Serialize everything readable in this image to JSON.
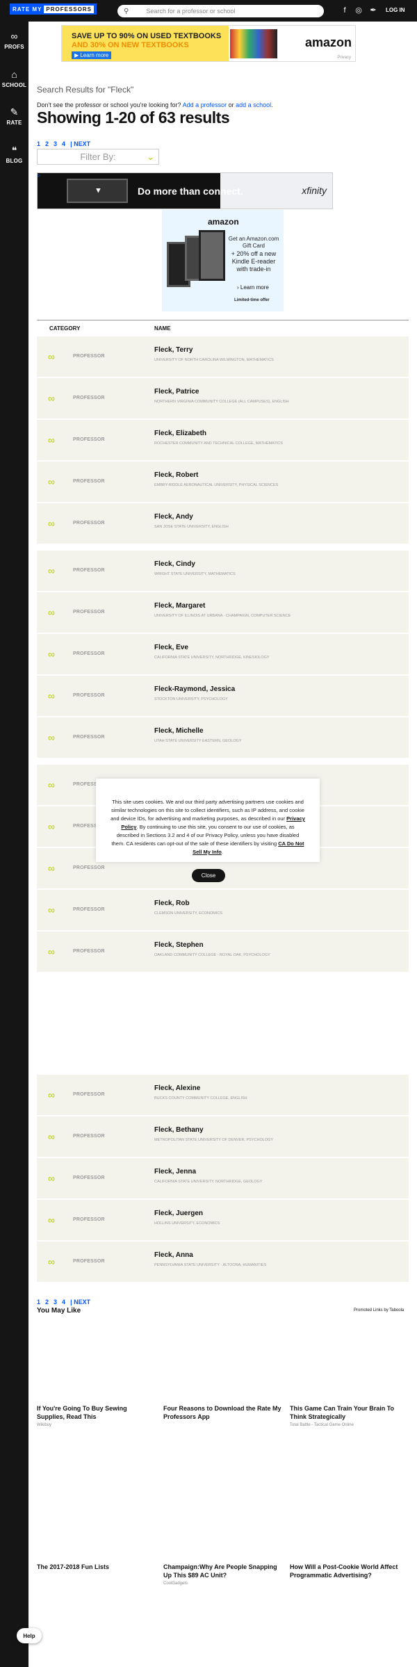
{
  "header": {
    "logo_part1": "RATE MY",
    "logo_part2": "PROFESSORS",
    "search_placeholder": "Search for a professor or school",
    "login": "LOG IN",
    "social": [
      "f",
      "◎",
      "✒"
    ]
  },
  "sidebar": {
    "items": [
      {
        "icon": "∞",
        "label": "PROFS"
      },
      {
        "icon": "⌂",
        "label": "SCHOOL"
      },
      {
        "icon": "✎",
        "label": "RATE"
      },
      {
        "icon": "❝",
        "label": "BLOG"
      }
    ]
  },
  "ad_top": {
    "line1": "SAVE UP TO 90% ON USED TEXTBOOKS",
    "line2": "AND 30% ON NEW TEXTBOOKS",
    "cta": "▶ Learn more",
    "brand": "amazon",
    "privacy": "Privacy"
  },
  "search": {
    "heading": "Search Results for \"Fleck\"",
    "dont_see": "Don't see the professor or school you're looking for? ",
    "add_professor": "Add a professor",
    "or": " or ",
    "add_school": "add a school.",
    "showing": "Showing 1-20 of 63 results",
    "pages": [
      "1",
      "2",
      "3",
      "4",
      "| NEXT"
    ],
    "filter_label": "Filter By:"
  },
  "ad_xfinity": {
    "text": "Do more than connect.",
    "brand": "xfinity",
    "adchoice": "▷"
  },
  "ad_kindle": {
    "brand": "amazon",
    "line1": "Get an Amazon.com Gift Card",
    "line2": "+ 20% off a new Kindle E-reader with trade-in",
    "cta": "› Learn more",
    "limited": "Limited-time offer"
  },
  "table": {
    "col_category": "CATEGORY",
    "col_name": "NAME",
    "category_label": "PROFESSOR",
    "rows": [
      {
        "name": "Fleck, Terry",
        "school": "UNIVERSITY OF NORTH CAROLINA WILMINGTON, MATHEMATICS"
      },
      {
        "name": "Fleck, Patrice",
        "school": "NORTHERN VIRGINIA COMMUNITY COLLEGE (ALL CAMPUSES), ENGLISH"
      },
      {
        "name": "Fleck, Elizabeth",
        "school": "ROCHESTER COMMUNITY AND TECHNICAL COLLEGE, MATHEMATICS"
      },
      {
        "name": "Fleck, Robert",
        "school": "EMBRY-RIDDLE AERONAUTICAL UNIVERSITY, PHYSICAL SCIENCES"
      },
      {
        "name": "Fleck, Andy",
        "school": "SAN JOSE STATE UNIVERSITY, ENGLISH"
      },
      {
        "name": "Fleck, Cindy",
        "school": "WRIGHT STATE UNIVERSITY, MATHEMATICS"
      },
      {
        "name": "Fleck, Margaret",
        "school": "UNIVERSITY OF ILLINOIS AT URBANA - CHAMPAIGN, COMPUTER SCIENCE"
      },
      {
        "name": "Fleck, Eve",
        "school": "CALIFORNIA STATE UNIVERSITY, NORTHRIDGE, KINESIOLOGY"
      },
      {
        "name": "Fleck-Raymond, Jessica",
        "school": "STOCKTON UNIVERSITY, PSYCHOLOGY"
      },
      {
        "name": "Fleck, Michelle",
        "school": "UTAH STATE UNIVERSITY EASTERN, GEOLOGY"
      },
      {
        "name": "",
        "school": ""
      },
      {
        "name": "",
        "school": ""
      },
      {
        "name": "",
        "school": ""
      },
      {
        "name": "Fleck, Rob",
        "school": "CLEMSON UNIVERSITY, ECONOMICS"
      },
      {
        "name": "Fleck, Stephen",
        "school": "OAKLAND COMMUNITY COLLEGE - ROYAL OAK, PSYCHOLOGY"
      },
      {
        "name": "Fleck, Alexine",
        "school": "BUCKS COUNTY COMMUNITY COLLEGE, ENGLISH"
      },
      {
        "name": "Fleck, Bethany",
        "school": "METROPOLITAN STATE UNIVERSITY OF DENVER, PSYCHOLOGY"
      },
      {
        "name": "Fleck, Jenna",
        "school": "CALIFORNIA STATE UNIVERSITY, NORTHRIDGE, GEOLOGY"
      },
      {
        "name": "Fleck, Juergen",
        "school": "HOLLINS UNIVERSITY, ECONOMICS"
      },
      {
        "name": "Fleck, Anna",
        "school": "PENNSYLVANIA STATE UNIVERSITY - ALTOONA, HUMANITIES"
      }
    ]
  },
  "cookie": {
    "text_1": "This site uses cookies. We and our third party advertising partners use cookies and similar technologies on this site to collect identifiers, such as IP address, and cookie and device IDs, for advertising and marketing purposes, as described in our ",
    "privacy_policy": "Privacy Policy",
    "text_2": ". By continuing to use this site, you consent to our use of cookies, as described in Sections 3.2 and 4 of our Privacy Policy, unless you have disabled them. CA residents can opt-out of the sale of these identifiers by visiting ",
    "do_not_sell": "CA Do Not Sell My Info",
    "text_3": ".",
    "close": "Close"
  },
  "you_may_like": {
    "title": "You May Like",
    "promoted": "Promoted Links by Taboola",
    "cards": [
      {
        "title": "If You're Going To Buy Sewing Supplies, Read This",
        "source": "Wikibuy"
      },
      {
        "title": "Four Reasons to Download the Rate My Professors App",
        "source": ""
      },
      {
        "title": "This Game Can Train Your Brain To Think Strategically",
        "source": "Total Battle - Tactical Game Online"
      },
      {
        "title": "The 2017-2018 Fun Lists",
        "source": ""
      },
      {
        "title": "Champaign:Why Are People Snapping Up This $89 AC Unit?",
        "source": "CoolGadgets"
      },
      {
        "title": "How Will a Post-Cookie World Affect Programmatic Advertising?",
        "source": ""
      }
    ]
  },
  "help": "Help"
}
